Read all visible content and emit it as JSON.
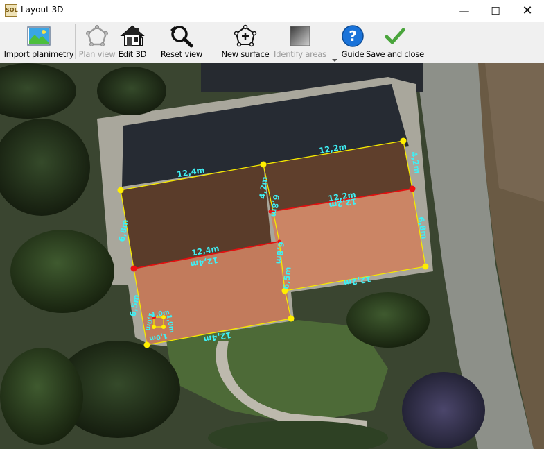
{
  "window": {
    "title": "Layout 3D",
    "app_icon_text": "SOL",
    "minimize_glyph": "—",
    "maximize_glyph": "☐",
    "close_glyph": "✕"
  },
  "toolbar": {
    "import_planimetry": {
      "label": "Import planimetry",
      "icon": "image-icon"
    },
    "plan_view": {
      "label": "Plan view",
      "icon": "pentagon-icon",
      "enabled": false
    },
    "edit_3d": {
      "label": "Edit 3D",
      "icon": "house-icon"
    },
    "reset_view": {
      "label": "Reset view",
      "icon": "magnifier-reset-icon"
    },
    "new_surface": {
      "label": "New surface",
      "icon": "polygon-add-icon"
    },
    "identify_areas": {
      "label": "Identify areas",
      "icon": "gradient-square-icon",
      "enabled": false
    },
    "guide": {
      "label": "Guide",
      "icon": "help-icon"
    },
    "save_and_close": {
      "label": "Save and close",
      "icon": "checkmark-icon"
    }
  },
  "surfaces": {
    "left_upper": {
      "top": "12,4m",
      "left": "6,8m",
      "right": "4,2m"
    },
    "left_ridge": {
      "above": "12,4m",
      "below": "12,4m"
    },
    "left_lower": {
      "left": "6,5m",
      "right": "6,8m",
      "bottom": "12,4m"
    },
    "right_upper": {
      "top": "12,2m",
      "right": "4,2m",
      "left": "6,8m"
    },
    "right_ridge": {
      "above": "12,2m",
      "below": "12,2m"
    },
    "right_lower": {
      "right": "6,8m",
      "left": "6,5m",
      "bottom": "12,2m"
    },
    "chimney": {
      "top": "1,0m",
      "right": "1,0m",
      "bottom": "1,0m",
      "left": "1,0m"
    }
  },
  "colors": {
    "outline": "#f5e800",
    "ridge": "#e11010",
    "vertex": "#ffee00",
    "ridge_vertex": "#ee1111",
    "dimension_text": "#3ff0f5",
    "roof_upper": "#5d3d2a",
    "roof_lower": "#c98061"
  }
}
